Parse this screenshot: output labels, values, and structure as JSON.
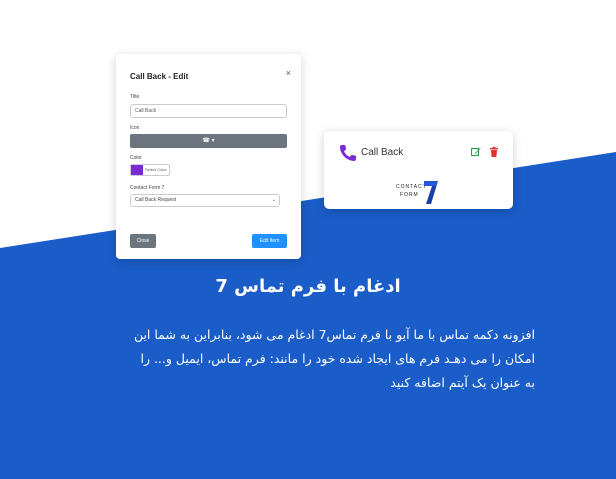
{
  "modal": {
    "title": "Call Back - Edit",
    "close_symbol": "×",
    "title_label": "Title",
    "title_value": "Call Back",
    "icon_label": "Icon",
    "icon_value": "☎ ▾",
    "color_label": "Color",
    "color_value": "#7b2bd6",
    "color_button_text": "Select Color",
    "form_label": "Contact Form 7",
    "form_value": "Call Back Request",
    "close_button": "Close",
    "edit_button": "Edit Item"
  },
  "card": {
    "label": "Call Back",
    "phone_icon": "phone-icon",
    "edit_icon": "edit-icon",
    "delete_icon": "trash-icon",
    "logo_line1": "CONTACT",
    "logo_line2": "FORM",
    "accent_color": "#7b2bd6",
    "edit_color": "#2ea44f",
    "delete_color": "#e03131"
  },
  "headline": "ادغام با فرم تماس 7",
  "body_lines": [
    "افزونه دکمه تماس با ما آیو با فرم تماس7 ادغام می شود، بنابراین به شما این",
    "امکان را می دهـد فرم های ایجاد شده خود را مانند: فرم تماس، ایمیل و... را",
    "به عنوان یک آیتم اضافه کنید"
  ],
  "colors": {
    "background_blue": "#1a5cc8",
    "button_blue": "#1e90ff",
    "button_gray": "#6c757d"
  }
}
